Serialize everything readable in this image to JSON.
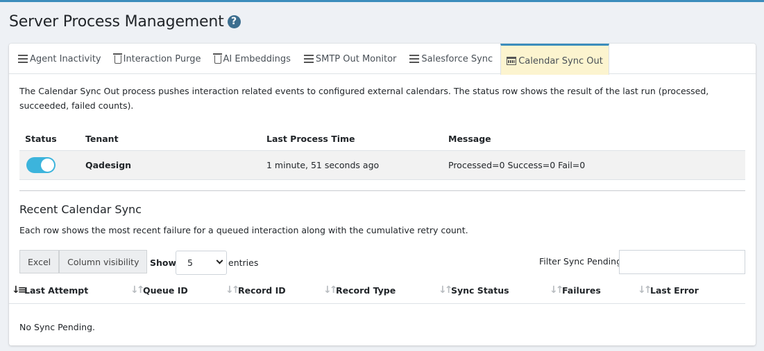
{
  "page": {
    "title": "Server Process Management",
    "help_icon": "?"
  },
  "tabs": [
    {
      "label": "Agent Inactivity",
      "icon": "list-icon",
      "active": false
    },
    {
      "label": "Interaction Purge",
      "icon": "trash-icon",
      "active": false
    },
    {
      "label": "AI Embeddings",
      "icon": "trash-icon",
      "active": false
    },
    {
      "label": "SMTP Out Monitor",
      "icon": "list-icon",
      "active": false
    },
    {
      "label": "Salesforce Sync",
      "icon": "list-icon",
      "active": false
    },
    {
      "label": "Calendar Sync Out",
      "icon": "calendar-icon",
      "active": true
    }
  ],
  "description": "The Calendar Sync Out process pushes interaction related events to configured external calendars. The status row shows the result of the last run (processed, succeeded, failed counts).",
  "status_table": {
    "headers": [
      "Status",
      "Tenant",
      "Last Process Time",
      "Message"
    ],
    "row": {
      "status_on": true,
      "tenant": "Qadesign",
      "last_process_time": "1 minute, 51 seconds ago",
      "message": "Processed=0 Success=0 Fail=0"
    }
  },
  "recent": {
    "title": "Recent Calendar Sync",
    "description": "Each row shows the most recent failure for a queued interaction along with the cumulative retry count.",
    "buttons": {
      "excel": "Excel",
      "column_visibility": "Column visibility"
    },
    "show_label": "Show",
    "entries_value": "5",
    "entries_label": "entries",
    "filter_label": "Filter Sync Pending",
    "filter_value": "",
    "columns": [
      "Last Attempt",
      "Queue ID",
      "Record ID",
      "Record Type",
      "Sync Status",
      "Failures",
      "Last Error"
    ],
    "empty_message": "No Sync Pending."
  },
  "colors": {
    "accent": "#3c8dbc",
    "active_tab_bg": "#fcf4cf",
    "toggle_on": "#3cb4dc"
  }
}
